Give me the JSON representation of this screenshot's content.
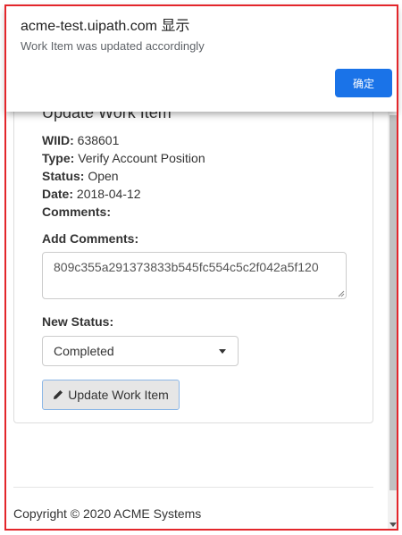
{
  "dialog": {
    "title": "acme-test.uipath.com 显示",
    "message": "Work Item was updated accordingly",
    "ok_label": "确定"
  },
  "panel": {
    "title": "Update Work Item"
  },
  "work_item": {
    "wiid_label": "WIID:",
    "wiid_value": "638601",
    "type_label": "Type:",
    "type_value": "Verify Account Position",
    "status_label": "Status:",
    "status_value": "Open",
    "date_label": "Date:",
    "date_value": "2018-04-12",
    "comments_label": "Comments:"
  },
  "form": {
    "add_comments_label": "Add Comments:",
    "add_comments_value": "809c355a291373833b545fc554c5c2f042a5f120",
    "new_status_label": "New Status:",
    "new_status_value": "Completed",
    "submit_label": "Update Work Item"
  },
  "footer": {
    "copyright": "Copyright © 2020 ACME Systems"
  },
  "colors": {
    "dialog_button": "#1a73e8",
    "frame": "#e3262b",
    "button_border": "#8cb7e6"
  }
}
